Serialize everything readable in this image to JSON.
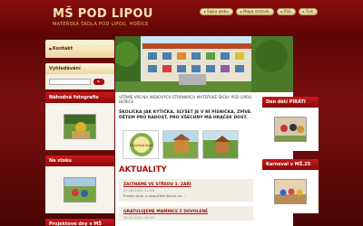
{
  "header": {
    "title": "MŠ POD LIPOU",
    "subtitle": "MATEŘSKÁ ŠKOLA POD LIPOU, HOŘICE",
    "links": [
      {
        "icon": "sitemap-icon",
        "label": "Šipka webu"
      },
      {
        "icon": "map-icon",
        "label": "Mapa stránek"
      },
      {
        "icon": "rss-icon",
        "label": "RSS"
      },
      {
        "icon": "print-icon",
        "label": "Tisk"
      }
    ]
  },
  "sidebar": {
    "kontakt": "Kontakt",
    "search_title": "Vyhledávání",
    "search_button": "►",
    "random_photo_title": "Náhodná fotografie",
    "nastoku_title": "Na stoku",
    "projekt_title": "Projektové dny v MŠ"
  },
  "main": {
    "welcome": "VÍTÁME VÁS NA WEBOVÝCH STRÁNKÁCH MATEŘSKÉ ŠKOLY POD LIPOU HOŘICE",
    "song": "ŠKOLIČKA JAK KYTIČKA, SLYŠET JE V NÍ PÍSNIČKA, ZPÍVÁ DĚTEM PRO RADOST, PRO VŠECHNY MÁ HRAČEK DOST.",
    "logo_text": "Mateřská škola",
    "news_title": "AKTUALITY",
    "news": [
      {
        "title": "ZAČÍNÁME VE STŘEDU 1. ZÁŘÍ",
        "date": "27.08.2021 11:56",
        "text": "Prosím dom a rozpočítat školní na ..."
      },
      {
        "title": "GRATULUJEME MAMINCE Z DOVOLENÉ",
        "date": "20.07.2021 10:29",
        "text": ""
      }
    ]
  },
  "right": {
    "den_title": "Den dětí PIRÁTI",
    "karneval_title": "Karneval v MŠ.25"
  }
}
